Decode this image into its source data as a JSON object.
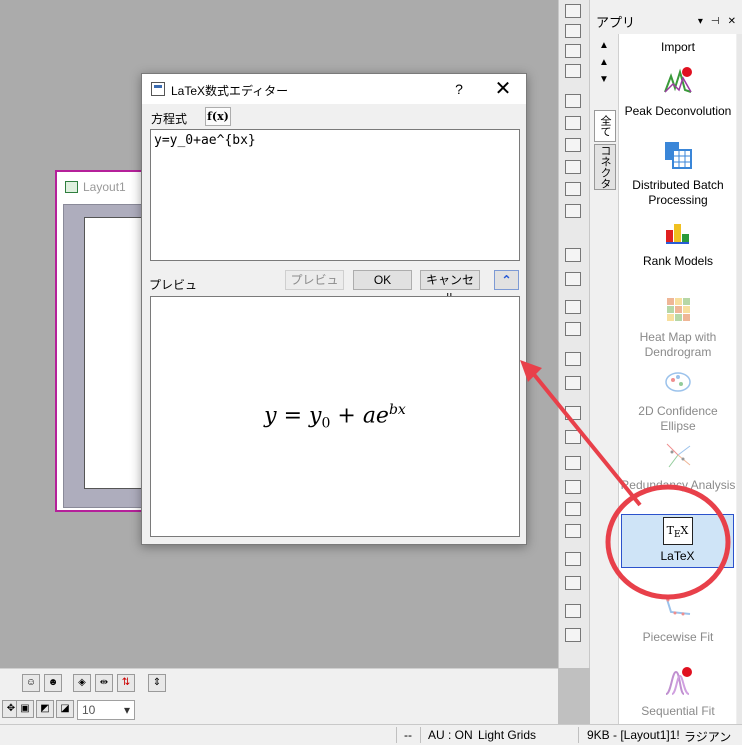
{
  "layout_window": {
    "title": "Layout1"
  },
  "latex_dialog": {
    "title": "LaTeX数式エディター",
    "help_label": "?",
    "close_label": "✕",
    "equation_label": "方程式",
    "fx_label": "f(x)",
    "equation_text": "y=y_0+ae^{bx}",
    "preview_label": "プレビュ",
    "preview_button": "プレビュー",
    "ok_button": "OK",
    "cancel_button": "キャンセル",
    "collapse_label": "⌃",
    "preview_formula": {
      "lhs": "y",
      "eq": " = ",
      "y": "y",
      "sub0": "0",
      "plus": " + ",
      "ae": "ae",
      "exp": "bx"
    }
  },
  "app_panel": {
    "title": "アプリ",
    "header_controls": [
      "▾",
      "⊣",
      "✕"
    ],
    "tabs": [
      "全て",
      "コネクタ"
    ],
    "items": [
      {
        "label": "Import",
        "icon": "import-icon"
      },
      {
        "label": "Peak Deconvolution",
        "icon": "peak-deconvolution-icon"
      },
      {
        "label": "Distributed Batch Processing",
        "icon": "batch-processing-icon"
      },
      {
        "label": "Rank Models",
        "icon": "rank-models-icon"
      },
      {
        "label": "Heat Map with Dendrogram",
        "icon": "heatmap-icon"
      },
      {
        "label": "2D Confidence Ellipse",
        "icon": "confidence-ellipse-icon"
      },
      {
        "label": "Redundancy Analysis",
        "icon": "redundancy-analysis-icon"
      },
      {
        "label": "LaTeX",
        "icon": "latex-icon"
      },
      {
        "label": "Piecewise Fit",
        "icon": "piecewise-fit-icon"
      },
      {
        "label": "Sequential Fit",
        "icon": "sequential-fit-icon"
      }
    ]
  },
  "toolbar": {
    "font_size_value": "10"
  },
  "status_bar": {
    "dashes": "--",
    "au": "AU : ON",
    "grid": "Light Grids",
    "info": "9KB - [Layout1]1!",
    "unit": "ラジアン"
  },
  "colors": {
    "annotation_red": "#e8404a",
    "selection_blue": "#2c52cc",
    "layout_border": "#b5209a"
  }
}
